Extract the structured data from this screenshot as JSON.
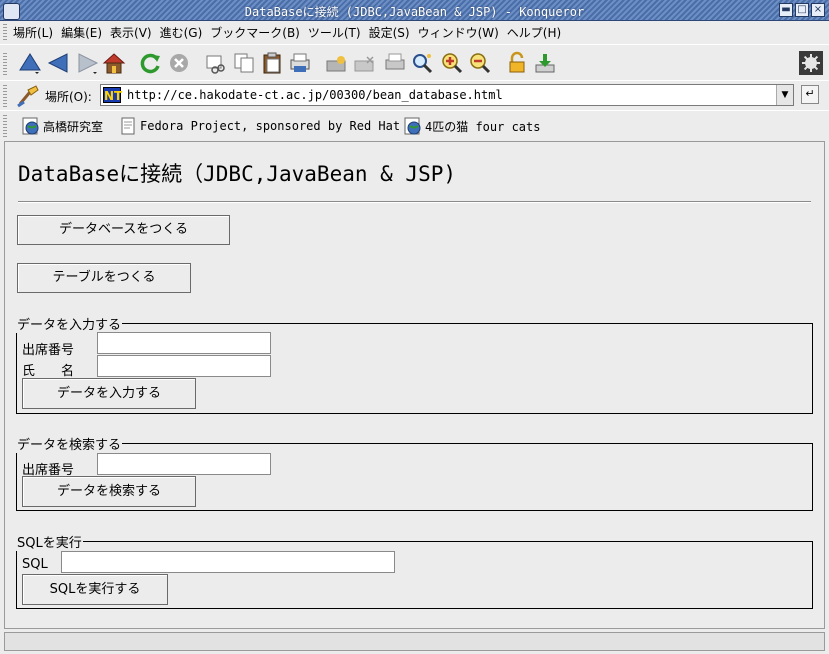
{
  "window": {
    "title": "DataBaseに接続 (JDBC,JavaBean & JSP) - Konqueror",
    "minimize_label": "▬",
    "maximize_label": "□",
    "close_label": "×"
  },
  "menu": {
    "items": [
      "場所(L)",
      "編集(E)",
      "表示(V)",
      "進む(G)",
      "ブックマーク(B)",
      "ツール(T)",
      "設定(S)",
      "ウィンドウ(W)",
      "ヘルプ(H)"
    ]
  },
  "toolbar": {
    "icons": [
      "up-arrow-icon",
      "back-arrow-icon",
      "forward-arrow-icon",
      "home-icon",
      "reload-icon",
      "stop-icon",
      "cut-icon",
      "copy-icon",
      "paste-icon",
      "print-icon",
      "security-icon",
      "security-disabled-icon",
      "print-frame-icon",
      "find-icon",
      "zoom-in-icon",
      "zoom-out-icon",
      "lock-icon",
      "download-icon"
    ]
  },
  "location": {
    "label": "場所(O):",
    "url": "http://ce.hakodate-ct.ac.jp/00300/bean_database.html",
    "favicon_text": "NT"
  },
  "bookmarks": [
    {
      "label": "高橋研究室"
    },
    {
      "label": "Fedora Project, sponsored by Red Hat"
    },
    {
      "label": "4匹の猫 four cats"
    }
  ],
  "page": {
    "heading": "DataBaseに接続（JDBC,JavaBean & JSP)",
    "create_db_button": "データベースをつくる",
    "create_table_button": "テーブルをつくる",
    "insert_section": {
      "legend": "データを入力する",
      "id_label": "出席番号",
      "name_label": "氏　　名",
      "id_value": "",
      "name_value": "",
      "submit": "データを入力する"
    },
    "search_section": {
      "legend": "データを検索する",
      "id_label": "出席番号",
      "id_value": "",
      "submit": "データを検索する"
    },
    "sql_section": {
      "legend": "SQLを実行",
      "sql_label": "SQL",
      "sql_value": "",
      "submit": "SQLを実行する"
    }
  }
}
